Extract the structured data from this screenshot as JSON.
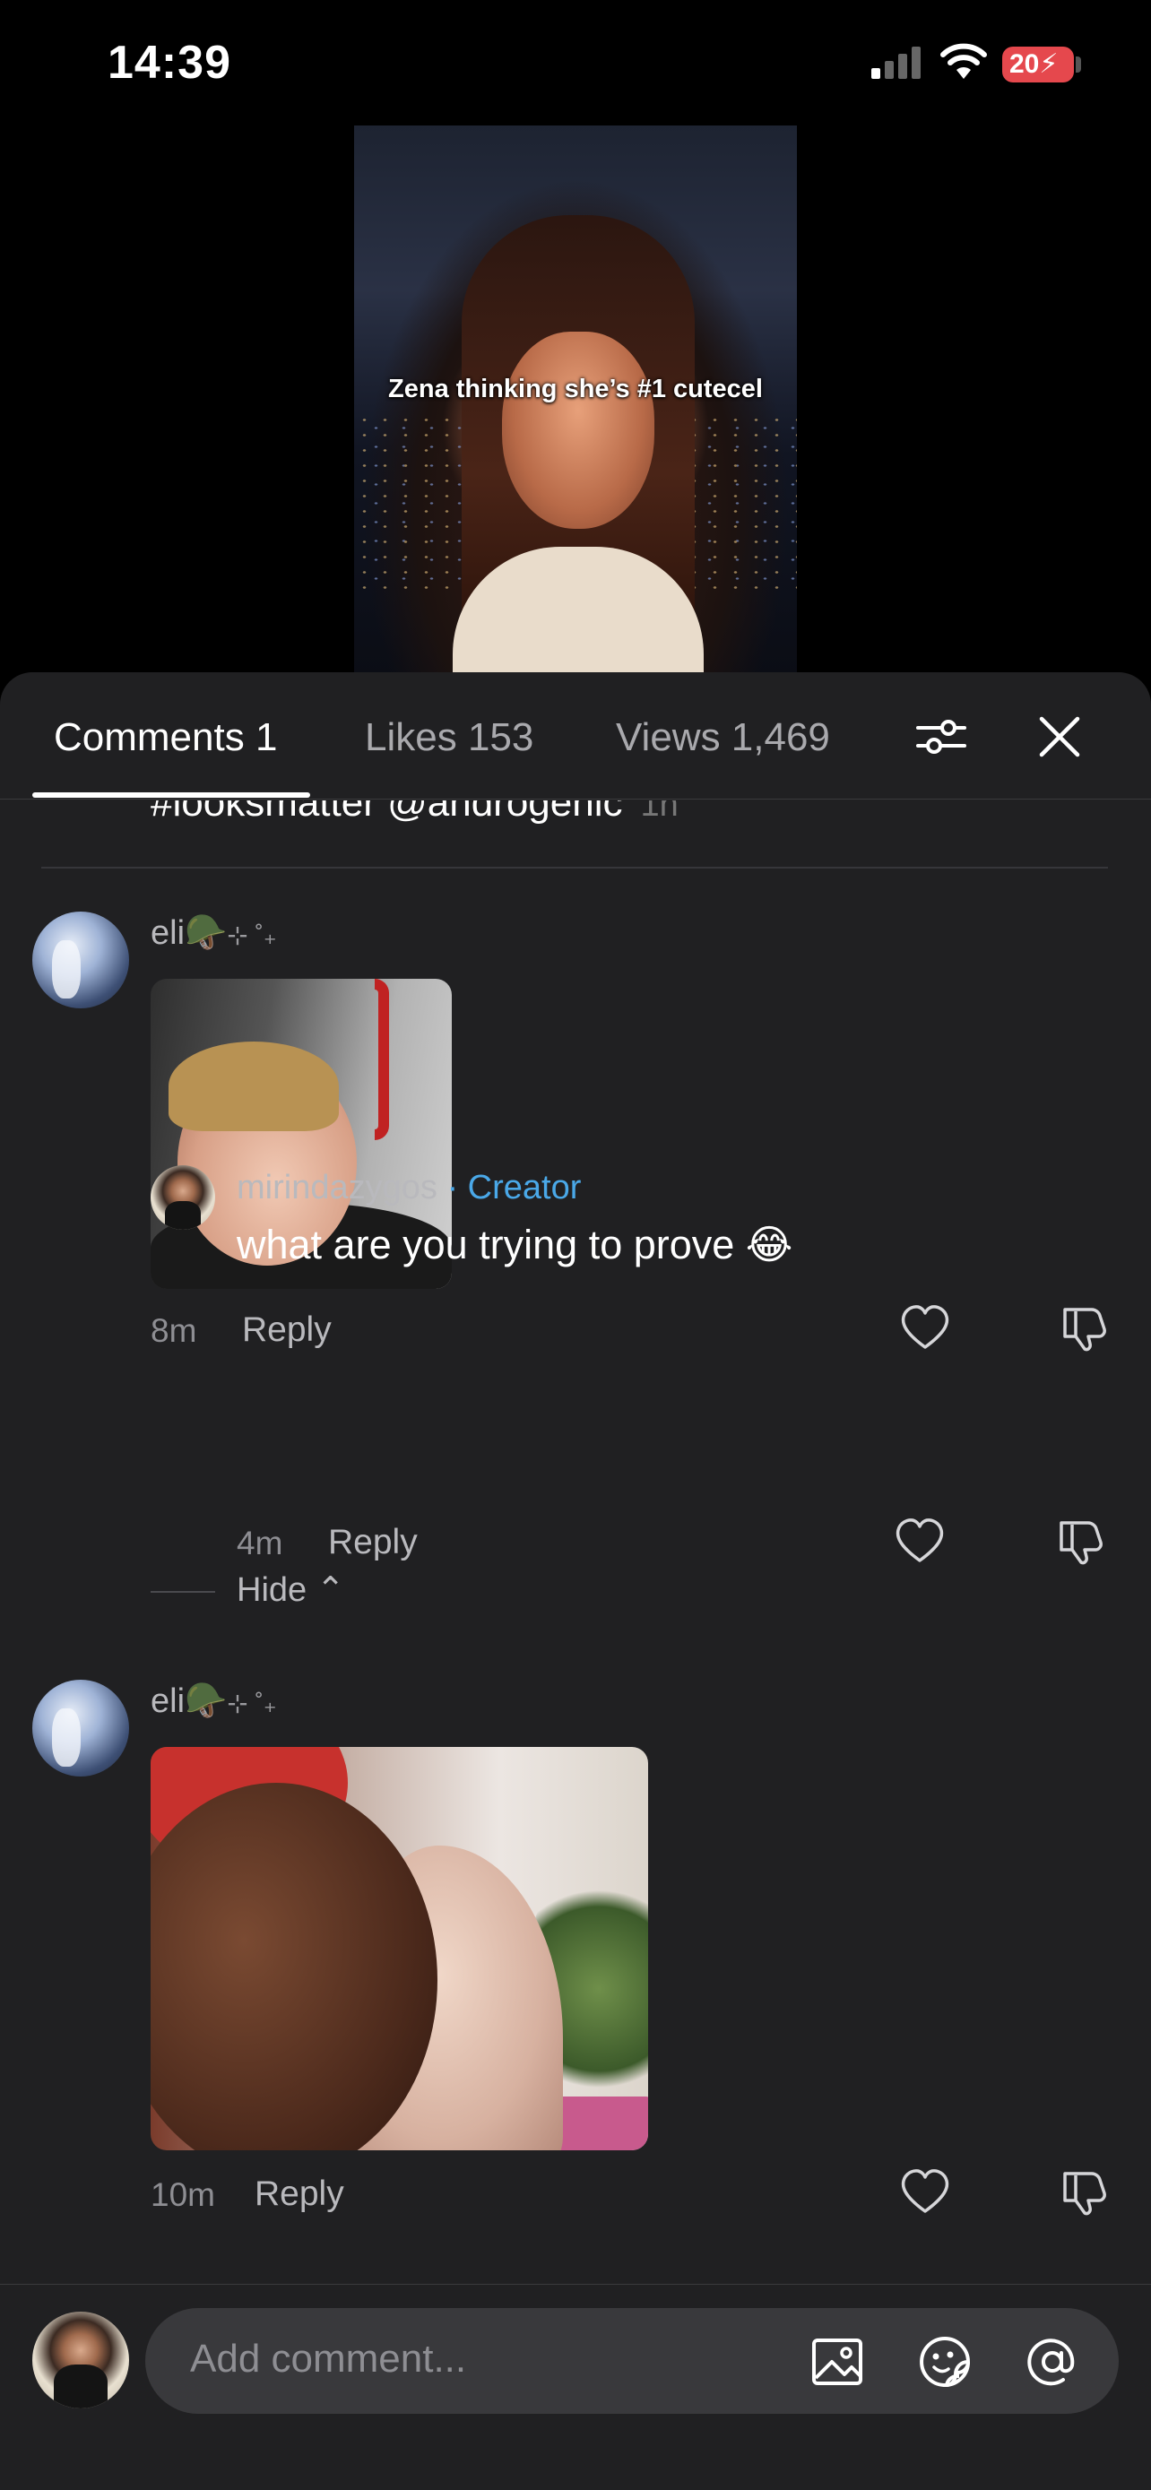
{
  "status_bar": {
    "time": "14:39",
    "battery": "20"
  },
  "video": {
    "caption": "Zena thinking she’s #1 cutecel"
  },
  "tabs": [
    {
      "label": "Comments 1"
    },
    {
      "label": "Likes 153"
    },
    {
      "label": "Views 1,469"
    }
  ],
  "icons": {
    "filter": "sliders-icon",
    "close": "close-icon",
    "like": "heart-icon",
    "dislike": "thumbs-down-icon",
    "image": "image-icon",
    "sticker": "sticker-icon",
    "mention": "at-icon"
  },
  "peek": {
    "text": "#looksmatter  @androgenic",
    "time": "1h"
  },
  "comments": [
    {
      "username": "eli🪖",
      "sparkle": "⊹ ˚₊",
      "time": "8m",
      "reply_label": "Reply"
    },
    {
      "username": "mirindazygos",
      "badge": "· Creator",
      "text": "what are you trying to prove 😂",
      "time": "4m",
      "reply_label": "Reply"
    },
    {
      "username": "eli🪖",
      "sparkle": "⊹ ˚₊",
      "time": "10m",
      "reply_label": "Reply"
    }
  ],
  "hide_label": "Hide ⌃",
  "composer": {
    "placeholder": "Add comment..."
  }
}
